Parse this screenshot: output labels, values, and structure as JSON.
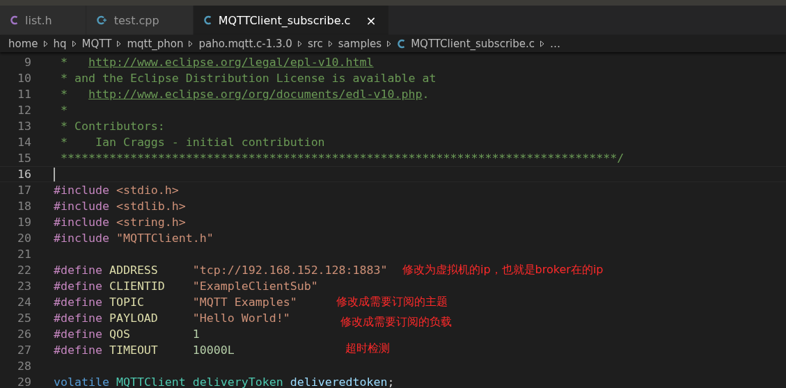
{
  "tabs": [
    {
      "label": "list.h",
      "kind": "c-header",
      "selected": false
    },
    {
      "label": "test.cpp",
      "kind": "cpp",
      "selected": false
    },
    {
      "label": "MQTTClient_subscribe.c",
      "kind": "c",
      "selected": true,
      "close": "×"
    }
  ],
  "breadcrumb": {
    "items": [
      "home",
      "hq",
      "MQTT",
      "mqtt_phon",
      "paho.mqtt.c-1.3.0",
      "src",
      "samples",
      "MQTTClient_subscribe.c"
    ],
    "more": "…"
  },
  "editor": {
    "lines": [
      {
        "number": "9",
        "tokens": [
          {
            "kind": "comment",
            "text": "*"
          },
          {
            "kind": "link",
            "text": "http://www.eclipse.org/legal/epl-v10.html"
          }
        ]
      },
      {
        "number": "10",
        "tokens": [
          {
            "kind": "comment",
            "text": "* and the Eclipse Distribution License is available at"
          }
        ]
      },
      {
        "number": "11",
        "tokens": [
          {
            "kind": "comment",
            "text": "*"
          },
          {
            "kind": "link",
            "text": "http://www.eclipse.org/org/documents/edl-v10.php"
          },
          {
            "kind": "comment",
            "text": "."
          }
        ]
      },
      {
        "number": "12",
        "tokens": [
          {
            "kind": "comment",
            "text": "*"
          }
        ]
      },
      {
        "number": "13",
        "tokens": [
          {
            "kind": "comment",
            "text": "* Contributors:"
          }
        ]
      },
      {
        "number": "14",
        "tokens": [
          {
            "kind": "comment",
            "text": "*    Ian Craggs - initial contribution"
          }
        ]
      },
      {
        "number": "15",
        "tokens": [
          {
            "kind": "comment",
            "text": "********************************************************************************/"
          }
        ]
      },
      {
        "number": "16",
        "current": true
      },
      {
        "number": "17",
        "tokens": [
          {
            "kind": "keyword",
            "text": "#include"
          },
          {
            "kind": "string",
            "text": "<stdio.h>"
          }
        ]
      },
      {
        "number": "18",
        "tokens": [
          {
            "kind": "keyword",
            "text": "#include"
          },
          {
            "kind": "string",
            "text": "<stdlib.h>"
          }
        ]
      },
      {
        "number": "19",
        "tokens": [
          {
            "kind": "keyword",
            "text": "#include"
          },
          {
            "kind": "string",
            "text": "<string.h>"
          }
        ]
      },
      {
        "number": "20",
        "tokens": [
          {
            "kind": "keyword",
            "text": "#include"
          },
          {
            "kind": "string",
            "text": "\"MQTTClient.h\""
          }
        ]
      },
      {
        "number": "21"
      },
      {
        "number": "22",
        "tokens": [
          {
            "kind": "keyword",
            "text": "#define"
          },
          {
            "kind": "macro",
            "text": "ADDRESS"
          },
          {
            "kind": "string",
            "text": "\"tcp://192.168.152.128:1883\""
          }
        ],
        "note": "修改为虚拟机的ip，也就是broker在的ip"
      },
      {
        "number": "23",
        "tokens": [
          {
            "kind": "keyword",
            "text": "#define"
          },
          {
            "kind": "macro",
            "text": "CLIENTID"
          },
          {
            "kind": "string",
            "text": "\"ExampleClientSub\""
          }
        ]
      },
      {
        "number": "24",
        "tokens": [
          {
            "kind": "keyword",
            "text": "#define"
          },
          {
            "kind": "macro",
            "text": "TOPIC"
          },
          {
            "kind": "string",
            "text": "\"MQTT Examples\""
          }
        ],
        "note": "修改成需要订阅的主题"
      },
      {
        "number": "25",
        "tokens": [
          {
            "kind": "keyword",
            "text": "#define"
          },
          {
            "kind": "macro",
            "text": "PAYLOAD"
          },
          {
            "kind": "string",
            "text": "\"Hello World!\""
          }
        ],
        "note": "修改成需要订阅的负载"
      },
      {
        "number": "26",
        "tokens": [
          {
            "kind": "keyword",
            "text": "#define"
          },
          {
            "kind": "macro",
            "text": "QOS"
          },
          {
            "kind": "number",
            "text": "1"
          }
        ]
      },
      {
        "number": "27",
        "tokens": [
          {
            "kind": "keyword",
            "text": "#define"
          },
          {
            "kind": "macro",
            "text": "TIMEOUT"
          },
          {
            "kind": "number",
            "text": "10000L"
          }
        ],
        "note": "超时检测"
      },
      {
        "number": "28"
      },
      {
        "number": "29",
        "tokens": [
          {
            "kind": "storage",
            "text": "volatile"
          },
          {
            "kind": "type",
            "text": "MQTTClient_deliveryToken"
          },
          {
            "kind": "variable",
            "text": "deliveredtoken"
          },
          {
            "kind": "plain",
            "text": ";"
          }
        ]
      }
    ]
  }
}
